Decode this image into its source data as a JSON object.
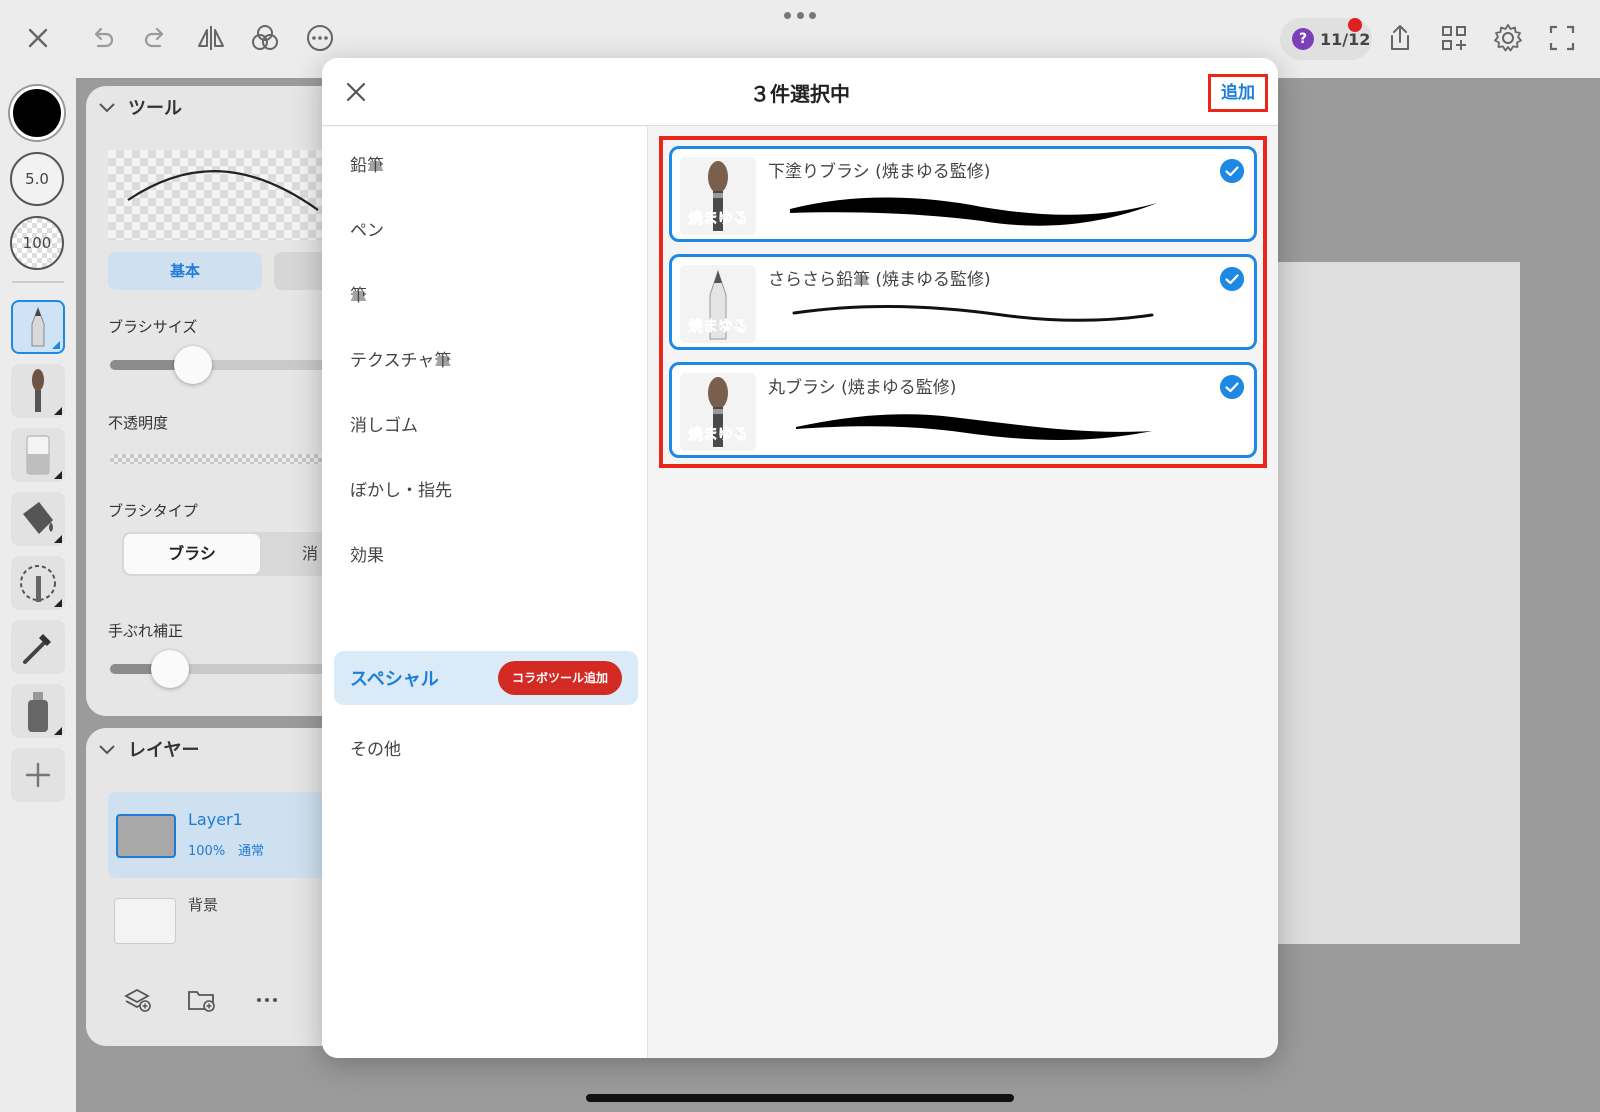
{
  "toolbar": {
    "help_count": "11/12",
    "icons": [
      "close-icon",
      "undo-icon",
      "redo-icon",
      "flip-icon",
      "blend-icon",
      "more-icon",
      "share-icon",
      "grid-add-icon",
      "gear-icon",
      "fullscreen-icon"
    ]
  },
  "leftstrip": {
    "brush_size": "5.0",
    "opacity": "100"
  },
  "tool_panel": {
    "title": "ツール",
    "tab_basic": "基本",
    "brush_size_label": "ブラシサイズ",
    "opacity_label": "不透明度",
    "brush_type_label": "ブラシタイプ",
    "brush_type_selected": "ブラシ",
    "brush_type_other": "消",
    "stabilizer_label": "手ぶれ補正",
    "brush_size_level": 0.36,
    "stabilizer_level": 0.26
  },
  "layer_panel": {
    "title": "レイヤー",
    "layer1_name": "Layer1",
    "layer1_meta": "100%　通常",
    "bg_name": "背景"
  },
  "dialog": {
    "title": "３件選択中",
    "add_label": "追加",
    "categories": [
      "鉛筆",
      "ペン",
      "筆",
      "テクスチャ筆",
      "消しゴム",
      "ぼかし・指先",
      "効果",
      "スペシャル",
      "その他"
    ],
    "selected_category": "スペシャル",
    "collab_badge": "コラボツール追加",
    "brushes": [
      {
        "name": "下塗りブラシ (焼まゆる監修)",
        "checked": true,
        "thumb_text": "焼まゆる"
      },
      {
        "name": "さらさら鉛筆 (焼まゆる監修)",
        "checked": true,
        "thumb_text": "焼まゆる"
      },
      {
        "name": "丸ブラシ (焼まゆる監修)",
        "checked": true,
        "thumb_text": "焼まゆる"
      }
    ]
  },
  "colors": {
    "accent": "#1e88e5",
    "highlight_frame": "#e8261a",
    "badge": "#d42a24"
  }
}
